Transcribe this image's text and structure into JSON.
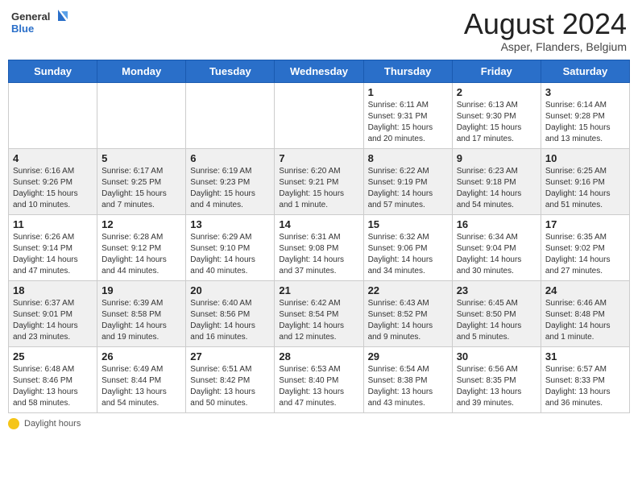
{
  "header": {
    "logo_general": "General",
    "logo_blue": "Blue",
    "month_year": "August 2024",
    "location": "Asper, Flanders, Belgium"
  },
  "weekdays": [
    "Sunday",
    "Monday",
    "Tuesday",
    "Wednesday",
    "Thursday",
    "Friday",
    "Saturday"
  ],
  "footer": {
    "daylight_label": "Daylight hours"
  },
  "weeks": [
    [
      {
        "day": "",
        "info": ""
      },
      {
        "day": "",
        "info": ""
      },
      {
        "day": "",
        "info": ""
      },
      {
        "day": "",
        "info": ""
      },
      {
        "day": "1",
        "info": "Sunrise: 6:11 AM\nSunset: 9:31 PM\nDaylight: 15 hours\nand 20 minutes."
      },
      {
        "day": "2",
        "info": "Sunrise: 6:13 AM\nSunset: 9:30 PM\nDaylight: 15 hours\nand 17 minutes."
      },
      {
        "day": "3",
        "info": "Sunrise: 6:14 AM\nSunset: 9:28 PM\nDaylight: 15 hours\nand 13 minutes."
      }
    ],
    [
      {
        "day": "4",
        "info": "Sunrise: 6:16 AM\nSunset: 9:26 PM\nDaylight: 15 hours\nand 10 minutes."
      },
      {
        "day": "5",
        "info": "Sunrise: 6:17 AM\nSunset: 9:25 PM\nDaylight: 15 hours\nand 7 minutes."
      },
      {
        "day": "6",
        "info": "Sunrise: 6:19 AM\nSunset: 9:23 PM\nDaylight: 15 hours\nand 4 minutes."
      },
      {
        "day": "7",
        "info": "Sunrise: 6:20 AM\nSunset: 9:21 PM\nDaylight: 15 hours\nand 1 minute."
      },
      {
        "day": "8",
        "info": "Sunrise: 6:22 AM\nSunset: 9:19 PM\nDaylight: 14 hours\nand 57 minutes."
      },
      {
        "day": "9",
        "info": "Sunrise: 6:23 AM\nSunset: 9:18 PM\nDaylight: 14 hours\nand 54 minutes."
      },
      {
        "day": "10",
        "info": "Sunrise: 6:25 AM\nSunset: 9:16 PM\nDaylight: 14 hours\nand 51 minutes."
      }
    ],
    [
      {
        "day": "11",
        "info": "Sunrise: 6:26 AM\nSunset: 9:14 PM\nDaylight: 14 hours\nand 47 minutes."
      },
      {
        "day": "12",
        "info": "Sunrise: 6:28 AM\nSunset: 9:12 PM\nDaylight: 14 hours\nand 44 minutes."
      },
      {
        "day": "13",
        "info": "Sunrise: 6:29 AM\nSunset: 9:10 PM\nDaylight: 14 hours\nand 40 minutes."
      },
      {
        "day": "14",
        "info": "Sunrise: 6:31 AM\nSunset: 9:08 PM\nDaylight: 14 hours\nand 37 minutes."
      },
      {
        "day": "15",
        "info": "Sunrise: 6:32 AM\nSunset: 9:06 PM\nDaylight: 14 hours\nand 34 minutes."
      },
      {
        "day": "16",
        "info": "Sunrise: 6:34 AM\nSunset: 9:04 PM\nDaylight: 14 hours\nand 30 minutes."
      },
      {
        "day": "17",
        "info": "Sunrise: 6:35 AM\nSunset: 9:02 PM\nDaylight: 14 hours\nand 27 minutes."
      }
    ],
    [
      {
        "day": "18",
        "info": "Sunrise: 6:37 AM\nSunset: 9:01 PM\nDaylight: 14 hours\nand 23 minutes."
      },
      {
        "day": "19",
        "info": "Sunrise: 6:39 AM\nSunset: 8:58 PM\nDaylight: 14 hours\nand 19 minutes."
      },
      {
        "day": "20",
        "info": "Sunrise: 6:40 AM\nSunset: 8:56 PM\nDaylight: 14 hours\nand 16 minutes."
      },
      {
        "day": "21",
        "info": "Sunrise: 6:42 AM\nSunset: 8:54 PM\nDaylight: 14 hours\nand 12 minutes."
      },
      {
        "day": "22",
        "info": "Sunrise: 6:43 AM\nSunset: 8:52 PM\nDaylight: 14 hours\nand 9 minutes."
      },
      {
        "day": "23",
        "info": "Sunrise: 6:45 AM\nSunset: 8:50 PM\nDaylight: 14 hours\nand 5 minutes."
      },
      {
        "day": "24",
        "info": "Sunrise: 6:46 AM\nSunset: 8:48 PM\nDaylight: 14 hours\nand 1 minute."
      }
    ],
    [
      {
        "day": "25",
        "info": "Sunrise: 6:48 AM\nSunset: 8:46 PM\nDaylight: 13 hours\nand 58 minutes."
      },
      {
        "day": "26",
        "info": "Sunrise: 6:49 AM\nSunset: 8:44 PM\nDaylight: 13 hours\nand 54 minutes."
      },
      {
        "day": "27",
        "info": "Sunrise: 6:51 AM\nSunset: 8:42 PM\nDaylight: 13 hours\nand 50 minutes."
      },
      {
        "day": "28",
        "info": "Sunrise: 6:53 AM\nSunset: 8:40 PM\nDaylight: 13 hours\nand 47 minutes."
      },
      {
        "day": "29",
        "info": "Sunrise: 6:54 AM\nSunset: 8:38 PM\nDaylight: 13 hours\nand 43 minutes."
      },
      {
        "day": "30",
        "info": "Sunrise: 6:56 AM\nSunset: 8:35 PM\nDaylight: 13 hours\nand 39 minutes."
      },
      {
        "day": "31",
        "info": "Sunrise: 6:57 AM\nSunset: 8:33 PM\nDaylight: 13 hours\nand 36 minutes."
      }
    ]
  ]
}
